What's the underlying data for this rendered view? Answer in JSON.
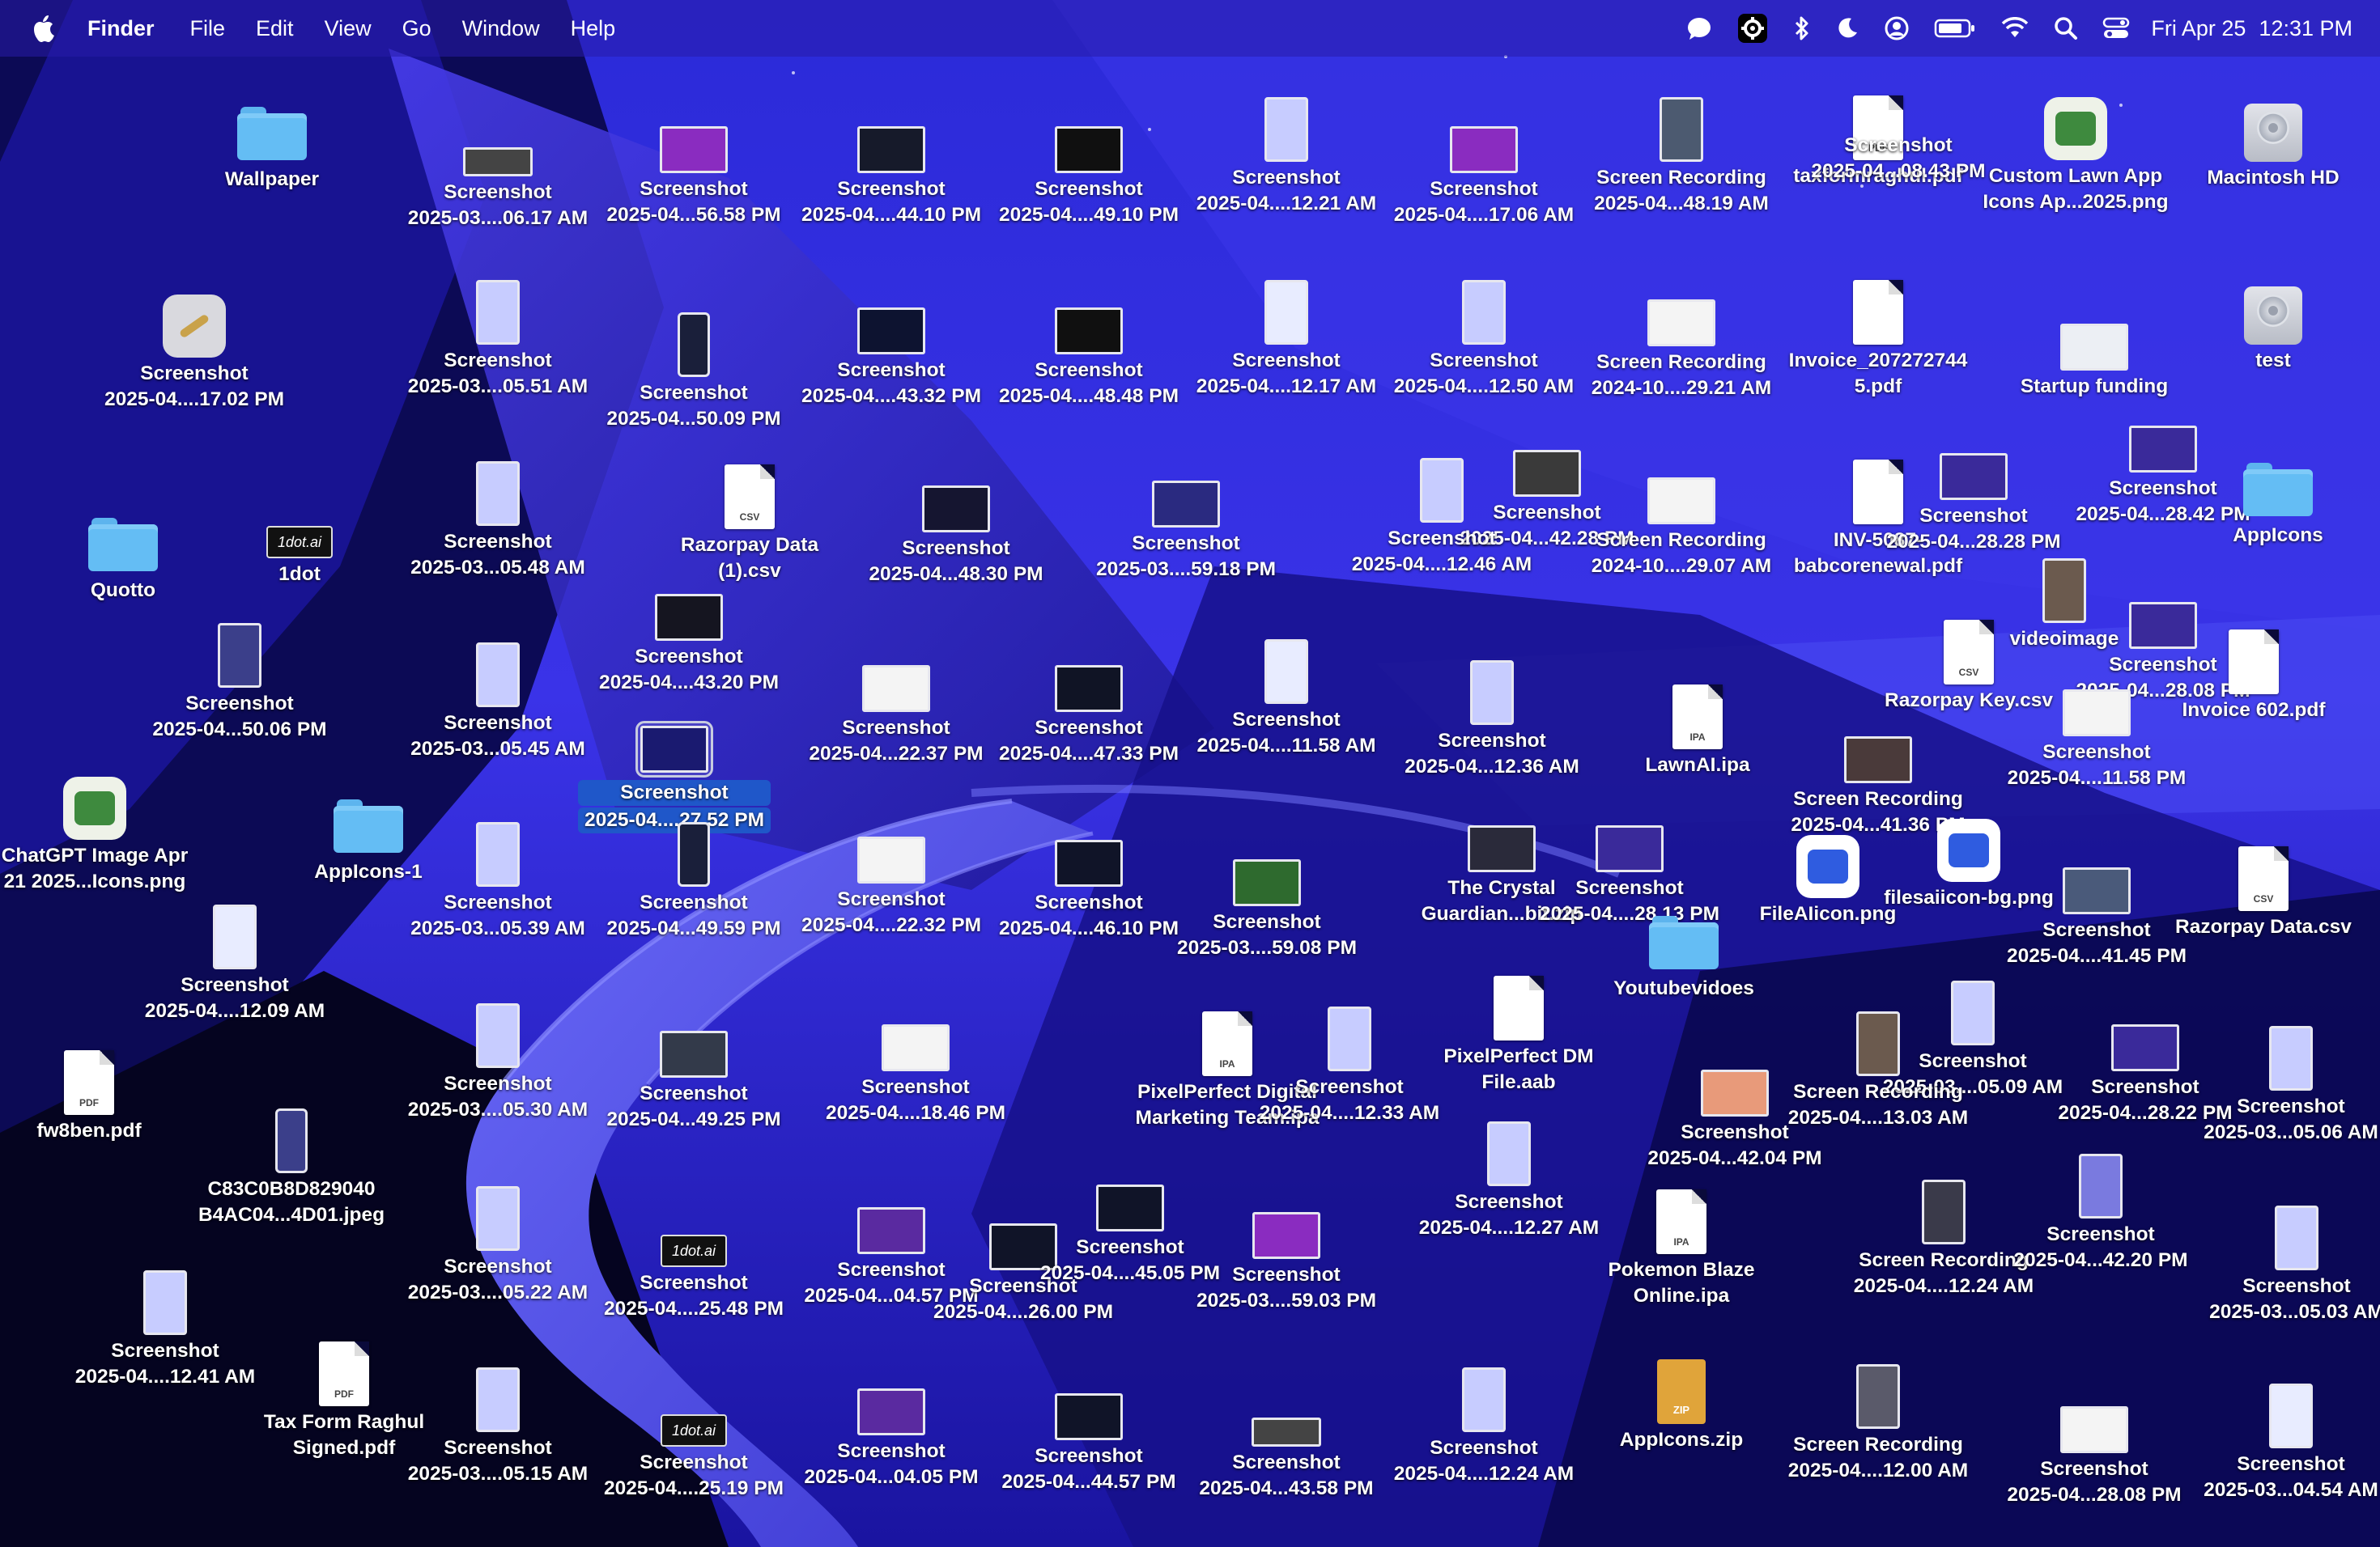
{
  "menubar": {
    "app_name": "Finder",
    "menus": [
      "File",
      "Edit",
      "View",
      "Go",
      "Window",
      "Help"
    ],
    "status_icons": [
      "chat-bubble-icon",
      "gear-badge-icon",
      "bluetooth-icon",
      "moon-icon",
      "user-circle-icon",
      "battery-icon",
      "wifi-icon",
      "search-icon",
      "control-center-icon"
    ],
    "date": "Fri Apr 25",
    "time": "12:31 PM"
  },
  "desktop": {
    "icons": [
      {
        "lines": [
          "Wallpaper"
        ],
        "kind": "folder"
      },
      {
        "lines": [
          "Screenshot",
          "2025-03....06.17 AM"
        ],
        "kind": "wide"
      },
      {
        "lines": [
          "Screenshot",
          "2025-04...56.58 PM"
        ],
        "kind": "landscape",
        "tint": "#8a2cc0"
      },
      {
        "lines": [
          "Screenshot",
          "2025-04....44.10 PM"
        ],
        "kind": "landscape",
        "tint": "#161a2a"
      },
      {
        "lines": [
          "Screenshot",
          "2025-04....49.10 PM"
        ],
        "kind": "landscape",
        "tint": "#101010"
      },
      {
        "lines": [
          "Screenshot",
          "2025-04....12.21 AM"
        ],
        "kind": "portrait",
        "tint": "#c7ccff"
      },
      {
        "lines": [
          "Screenshot",
          "2025-04....17.06 AM"
        ],
        "kind": "landscape",
        "tint": "#8a2cc0"
      },
      {
        "lines": [
          "Screen Recording",
          "2025-04...48.19 AM"
        ],
        "kind": "portrait",
        "tint": "#4c5a70"
      },
      {
        "lines": [
          "taxformraghul.pdf"
        ],
        "kind": "doc",
        "badge": "PDF"
      },
      {
        "lines": [
          "Screenshot",
          "2025-04...08.43 PM"
        ],
        "kind": "none"
      },
      {
        "lines": [
          "Custom Lawn App",
          "Icons Ap...2025.png"
        ],
        "kind": "app-grid"
      },
      {
        "lines": [
          "Macintosh HD"
        ],
        "kind": "disk"
      },
      {
        "lines": [
          "Screenshot",
          "2025-04....17.02 PM"
        ],
        "kind": "app-wand"
      },
      {
        "lines": [
          "Screenshot",
          "2025-03....05.51 AM"
        ],
        "kind": "portrait",
        "tint": "#c7ccff"
      },
      {
        "lines": [
          "Screenshot",
          "2025-04...50.09 PM"
        ],
        "kind": "phone",
        "tint": "#1a1f3a"
      },
      {
        "lines": [
          "Screenshot",
          "2025-04....43.32 PM"
        ],
        "kind": "landscape",
        "tint": "#0d1330"
      },
      {
        "lines": [
          "Screenshot",
          "2025-04....48.48 PM"
        ],
        "kind": "landscape",
        "tint": "#101010"
      },
      {
        "lines": [
          "Screenshot",
          "2025-04....12.17 AM"
        ],
        "kind": "portrait",
        "tint": "#e8ecff"
      },
      {
        "lines": [
          "Screenshot",
          "2025-04....12.50 AM"
        ],
        "kind": "portrait",
        "tint": "#c7ccff"
      },
      {
        "lines": [
          "Screen Recording",
          "2024-10....29.21 AM"
        ],
        "kind": "landscape",
        "tint": "#f4f4f4"
      },
      {
        "lines": [
          "Invoice_207272744",
          "5.pdf"
        ],
        "kind": "doc",
        "badge": ""
      },
      {
        "lines": [
          "Startup funding"
        ],
        "kind": "landscape",
        "tint": "#eceff4"
      },
      {
        "lines": [
          "test"
        ],
        "kind": "disk"
      },
      {
        "lines": [
          "Quotto"
        ],
        "kind": "folder"
      },
      {
        "lines": [
          "1dot"
        ],
        "kind": "logo",
        "logo_text": "1dot.ai"
      },
      {
        "lines": [
          "Screenshot",
          "2025-03...05.48 AM"
        ],
        "kind": "portrait",
        "tint": "#c7ccff"
      },
      {
        "lines": [
          "Razorpay Data",
          "(1).csv"
        ],
        "kind": "doc",
        "badge": "CSV"
      },
      {
        "lines": [
          "Screenshot",
          "2025-04...48.30 PM"
        ],
        "kind": "landscape",
        "tint": "#151530"
      },
      {
        "lines": [
          "Screenshot",
          "2025-03....59.18 PM"
        ],
        "kind": "landscape",
        "tint": "#2a2a80"
      },
      {
        "lines": [
          "Screenshot",
          "2025-04...42.28 PM"
        ],
        "kind": "landscape",
        "tint": "#3a3a3a"
      },
      {
        "lines": [
          "Screenshot",
          "2025-04....12.46 AM"
        ],
        "kind": "portrait",
        "tint": "#c7ccff"
      },
      {
        "lines": [
          "Screen Recording",
          "2024-10....29.07 AM"
        ],
        "kind": "landscape",
        "tint": "#f4f4f4"
      },
      {
        "lines": [
          "INV-5087-",
          "babcorenewal.pdf"
        ],
        "kind": "doc",
        "badge": ""
      },
      {
        "lines": [
          "Screenshot",
          "2025-04...28.28 PM"
        ],
        "kind": "landscape",
        "tint": "#3a2a9a"
      },
      {
        "lines": [
          "videoimage"
        ],
        "kind": "portrait",
        "tint": "#6b5a4e"
      },
      {
        "lines": [
          "Screenshot",
          "2025-04...28.42 PM"
        ],
        "kind": "landscape",
        "tint": "#3a2a9a"
      },
      {
        "lines": [
          "AppIcons"
        ],
        "kind": "folder"
      },
      {
        "lines": [
          "Screenshot",
          "2025-04...50.06 PM"
        ],
        "kind": "portrait",
        "tint": "#3b3f8a"
      },
      {
        "lines": [
          "Screenshot",
          "2025-04....43.20 PM"
        ],
        "kind": "landscape",
        "tint": "#151520"
      },
      {
        "lines": [
          "Screenshot",
          "2025-03...05.45 AM"
        ],
        "kind": "portrait",
        "tint": "#c7ccff"
      },
      {
        "lines": [
          "Screenshot",
          "2025-04....27.52 PM"
        ],
        "kind": "landscape",
        "tint": "#1a1a70",
        "selected": true
      },
      {
        "lines": [
          "Screenshot",
          "2025-04...22.37 PM"
        ],
        "kind": "landscape",
        "tint": "#f4f4f4"
      },
      {
        "lines": [
          "Screenshot",
          "2025-04....47.33 PM"
        ],
        "kind": "landscape",
        "tint": "#101425"
      },
      {
        "lines": [
          "Screenshot",
          "2025-04....11.58 AM"
        ],
        "kind": "portrait",
        "tint": "#e8ecff"
      },
      {
        "lines": [
          "Screenshot",
          "2025-04...12.36 AM"
        ],
        "kind": "portrait",
        "tint": "#c7ccff"
      },
      {
        "lines": [
          "LawnAI.ipa"
        ],
        "kind": "doc",
        "badge": "IPA"
      },
      {
        "lines": [
          "Razorpay Key.csv"
        ],
        "kind": "doc",
        "badge": "CSV"
      },
      {
        "lines": [
          "Screen Recording",
          "2025-04...41.36 PM"
        ],
        "kind": "landscape",
        "tint": "#4a3a3a"
      },
      {
        "lines": [
          "Screenshot",
          "2025-04...28.08 PM"
        ],
        "kind": "landscape",
        "tint": "#3a2a9a"
      },
      {
        "lines": [
          "Invoice 602.pdf"
        ],
        "kind": "doc",
        "badge": ""
      },
      {
        "lines": [
          "Screenshot",
          "2025-04....11.58 PM"
        ],
        "kind": "landscape",
        "tint": "#f4f4f4"
      },
      {
        "lines": [
          "ChatGPT Image Apr",
          "21 2025...Icons.png"
        ],
        "kind": "app-grid"
      },
      {
        "lines": [
          "AppIcons-1"
        ],
        "kind": "folder"
      },
      {
        "lines": [
          "Screenshot",
          "2025-04....12.09 AM"
        ],
        "kind": "portrait",
        "tint": "#e8ecff"
      },
      {
        "lines": [
          "Screenshot",
          "2025-03...05.39 AM"
        ],
        "kind": "portrait",
        "tint": "#c7ccff"
      },
      {
        "lines": [
          "Screenshot",
          "2025-04...49.59 PM"
        ],
        "kind": "phone",
        "tint": "#1a1f3a"
      },
      {
        "lines": [
          "Screenshot",
          "2025-04....22.32 PM"
        ],
        "kind": "landscape",
        "tint": "#f4f4f4"
      },
      {
        "lines": [
          "Screenshot",
          "2025-04....46.10 PM"
        ],
        "kind": "landscape",
        "tint": "#101428"
      },
      {
        "lines": [
          "Screenshot",
          "2025-03....59.08 PM"
        ],
        "kind": "landscape",
        "tint": "#2e6a2e"
      },
      {
        "lines": [
          "The Crystal",
          "Guardian...bit.zip"
        ],
        "kind": "landscape",
        "tint": "#2a2a3a"
      },
      {
        "lines": [
          "Screenshot",
          "2025-04....28.13 PM"
        ],
        "kind": "landscape",
        "tint": "#3a2a9a"
      },
      {
        "lines": [
          "Youtubevidoes"
        ],
        "kind": "folder"
      },
      {
        "lines": [
          "FileAIicon.png"
        ],
        "kind": "app"
      },
      {
        "lines": [
          "filesaiicon-bg.png"
        ],
        "kind": "app"
      },
      {
        "lines": [
          "Screenshot",
          "2025-04....41.45 PM"
        ],
        "kind": "landscape",
        "tint": "#4a5a7a"
      },
      {
        "lines": [
          "Razorpay Data.csv"
        ],
        "kind": "doc",
        "badge": "CSV"
      },
      {
        "lines": [
          "fw8ben.pdf"
        ],
        "kind": "doc",
        "badge": "PDF"
      },
      {
        "lines": [
          "Screenshot",
          "2025-03....05.30 AM"
        ],
        "kind": "portrait",
        "tint": "#c7ccff"
      },
      {
        "lines": [
          "Screenshot",
          "2025-04...49.25 PM"
        ],
        "kind": "landscape",
        "tint": "#333a4a"
      },
      {
        "lines": [
          "Screenshot",
          "2025-04....18.46 PM"
        ],
        "kind": "landscape",
        "tint": "#f4f4f4"
      },
      {
        "lines": [
          "PixelPerfect Digital",
          "Marketing Team.ipa"
        ],
        "kind": "doc",
        "badge": "IPA"
      },
      {
        "lines": [
          "Screenshot",
          "2025-04....12.33 AM"
        ],
        "kind": "portrait",
        "tint": "#c7ccff"
      },
      {
        "lines": [
          "PixelPerfect DM",
          "File.aab"
        ],
        "kind": "doc",
        "badge": ""
      },
      {
        "lines": [
          "Screenshot",
          "2025-04...42.04 PM"
        ],
        "kind": "landscape",
        "tint": "#e89a7a"
      },
      {
        "lines": [
          "Screenshot",
          "2025-03....05.09 AM"
        ],
        "kind": "portrait",
        "tint": "#c7ccff"
      },
      {
        "lines": [
          "Screen Recording",
          "2025-04....13.03 AM"
        ],
        "kind": "portrait",
        "tint": "#6b5a4e"
      },
      {
        "lines": [
          "Screenshot",
          "2025-04...28.22 PM"
        ],
        "kind": "landscape",
        "tint": "#3a2a9a"
      },
      {
        "lines": [
          "Screenshot",
          "2025-03...05.06 AM"
        ],
        "kind": "portrait",
        "tint": "#c7ccff"
      },
      {
        "lines": [
          "C83C0B8D829040",
          "B4AC04...4D01.jpeg"
        ],
        "kind": "phone",
        "tint": "#3b3f8a"
      },
      {
        "lines": [
          "Screenshot",
          "2025-03....05.22 AM"
        ],
        "kind": "portrait",
        "tint": "#c7ccff"
      },
      {
        "lines": [
          "Screenshot",
          "2025-04....25.48 PM"
        ],
        "kind": "logo",
        "logo_text": "1dot.ai"
      },
      {
        "lines": [
          "Screenshot",
          "2025-04...04.57 PM"
        ],
        "kind": "landscape",
        "tint": "#5a2aa0"
      },
      {
        "lines": [
          "Screenshot",
          "2025-04....26.00 PM"
        ],
        "kind": "landscape",
        "tint": "#101428"
      },
      {
        "lines": [
          "Screenshot",
          "2025-04....45.05 PM"
        ],
        "kind": "landscape",
        "tint": "#101428"
      },
      {
        "lines": [
          "Screenshot",
          "2025-03....59.03 PM"
        ],
        "kind": "landscape",
        "tint": "#8a2cc0"
      },
      {
        "lines": [
          "Screenshot",
          "2025-04....12.27 AM"
        ],
        "kind": "portrait",
        "tint": "#c7ccff"
      },
      {
        "lines": [
          "Pokemon Blaze",
          "Online.ipa"
        ],
        "kind": "doc",
        "badge": "IPA"
      },
      {
        "lines": [
          "Screen Recording",
          "2025-04....12.24 AM"
        ],
        "kind": "portrait",
        "tint": "#3a3a4a"
      },
      {
        "lines": [
          "Screenshot",
          "2025-04...42.20 PM"
        ],
        "kind": "portrait",
        "tint": "#7a7adf"
      },
      {
        "lines": [
          "Screenshot",
          "2025-03...05.03 AM"
        ],
        "kind": "portrait",
        "tint": "#c7ccff"
      },
      {
        "lines": [
          "Screenshot",
          "2025-04....12.41 AM"
        ],
        "kind": "portrait",
        "tint": "#c7ccff"
      },
      {
        "lines": [
          "Tax Form Raghul",
          "Signed.pdf"
        ],
        "kind": "doc",
        "badge": "PDF"
      },
      {
        "lines": [
          "Screenshot",
          "2025-03....05.15 AM"
        ],
        "kind": "portrait",
        "tint": "#c7ccff"
      },
      {
        "lines": [
          "Screenshot",
          "2025-04....25.19 PM"
        ],
        "kind": "logo",
        "logo_text": "1dot.ai"
      },
      {
        "lines": [
          "Screenshot",
          "2025-04...04.05 PM"
        ],
        "kind": "landscape",
        "tint": "#5a2aa0"
      },
      {
        "lines": [
          "Screenshot",
          "2025-04...44.57 PM"
        ],
        "kind": "landscape",
        "tint": "#101428"
      },
      {
        "lines": [
          "Screenshot",
          "2025-04...43.58 PM"
        ],
        "kind": "wide"
      },
      {
        "lines": [
          "Screenshot",
          "2025-04....12.24 AM"
        ],
        "kind": "portrait",
        "tint": "#c7ccff"
      },
      {
        "lines": [
          "AppIcons.zip"
        ],
        "kind": "zip",
        "badge": "ZIP"
      },
      {
        "lines": [
          "Screen Recording",
          "2025-04....12.00 AM"
        ],
        "kind": "portrait",
        "tint": "#5a5a6a"
      },
      {
        "lines": [
          "Screenshot",
          "2025-04...28.08 PM"
        ],
        "kind": "landscape",
        "tint": "#f4f4f4"
      },
      {
        "lines": [
          "Screenshot",
          "2025-03...04.54 AM"
        ],
        "kind": "portrait",
        "tint": "#e8ecff"
      }
    ]
  }
}
